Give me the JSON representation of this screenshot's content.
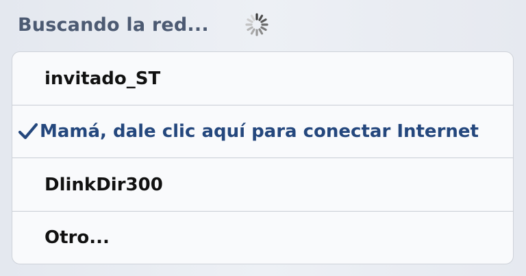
{
  "header": {
    "title": "Buscando la red...",
    "spinner_icon": "loading-spinner-icon"
  },
  "networks": [
    {
      "label": "invitado_ST",
      "selected": false
    },
    {
      "label": "Mamá, dale clic aquí para conectar Internet",
      "selected": true,
      "icon": "checkmark-icon"
    },
    {
      "label": "DlinkDir300",
      "selected": false
    },
    {
      "label": "Otro...",
      "selected": false
    }
  ],
  "colors": {
    "selected_text": "#24477d",
    "header_text": "#4c5a72"
  }
}
